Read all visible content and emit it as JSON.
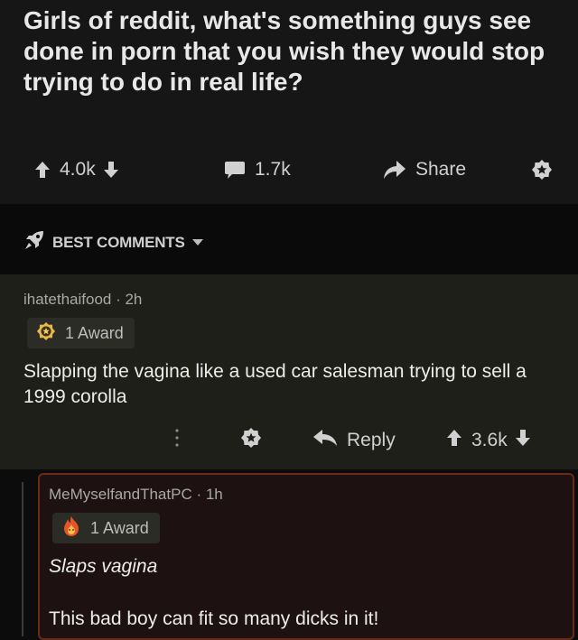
{
  "post": {
    "title": "Girls of reddit, what's something guys see done in porn that you wish they would stop trying to do in real life?",
    "upvotes": "4.0k",
    "comments": "1.7k",
    "share_label": "Share"
  },
  "sort": {
    "label": "BEST COMMENTS"
  },
  "comment1": {
    "meta": "ihatethaifood · 2h",
    "award": "1 Award",
    "body": "Slapping the vagina like a used car salesman trying to sell a 1999 corolla",
    "reply_label": "Reply",
    "score": "3.6k"
  },
  "comment2": {
    "meta": "MeMyselfandThatPC · 1h",
    "award": "1 Award",
    "body_line1": "Slaps vagina",
    "body_line2": "This bad boy can fit so many dicks in it!"
  },
  "icons": {
    "upvote": "arrow-up-icon",
    "downvote": "arrow-down-icon",
    "comment": "comment-bubble-icon",
    "share": "share-arrow-icon",
    "save": "star-badge-icon",
    "sort": "rocket-icon",
    "reply": "reply-arrow-icon",
    "more": "vertical-dots-icon"
  },
  "colors": {
    "post_bg": "#161617",
    "comment_bg": "#1f1f19",
    "highlight_border": "#6a2a16"
  }
}
